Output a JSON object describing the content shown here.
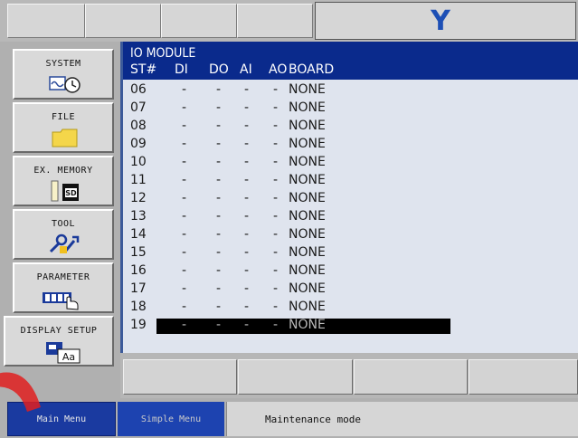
{
  "header": {
    "logo": "Y"
  },
  "left_menu": [
    {
      "label": "SYSTEM",
      "icon": "system-clock-icon"
    },
    {
      "label": "FILE",
      "icon": "folder-icon"
    },
    {
      "label": "EX. MEMORY",
      "icon": "sd-card-icon"
    },
    {
      "label": "TOOL",
      "icon": "tool-icon"
    },
    {
      "label": "PARAMETER",
      "icon": "parameter-hand-icon"
    },
    {
      "label": "DISPLAY SETUP",
      "icon": "display-setup-icon"
    }
  ],
  "main": {
    "title": "IO MODULE",
    "columns": [
      "ST#",
      "DI",
      "DO",
      "AI",
      "AO",
      "BOARD"
    ],
    "rows": [
      {
        "st": "06",
        "di": "-",
        "do": "-",
        "ai": "-",
        "ao": "-",
        "board": "NONE"
      },
      {
        "st": "07",
        "di": "-",
        "do": "-",
        "ai": "-",
        "ao": "-",
        "board": "NONE"
      },
      {
        "st": "08",
        "di": "-",
        "do": "-",
        "ai": "-",
        "ao": "-",
        "board": "NONE"
      },
      {
        "st": "09",
        "di": "-",
        "do": "-",
        "ai": "-",
        "ao": "-",
        "board": "NONE"
      },
      {
        "st": "10",
        "di": "-",
        "do": "-",
        "ai": "-",
        "ao": "-",
        "board": "NONE"
      },
      {
        "st": "11",
        "di": "-",
        "do": "-",
        "ai": "-",
        "ao": "-",
        "board": "NONE"
      },
      {
        "st": "12",
        "di": "-",
        "do": "-",
        "ai": "-",
        "ao": "-",
        "board": "NONE"
      },
      {
        "st": "13",
        "di": "-",
        "do": "-",
        "ai": "-",
        "ao": "-",
        "board": "NONE"
      },
      {
        "st": "14",
        "di": "-",
        "do": "-",
        "ai": "-",
        "ao": "-",
        "board": "NONE"
      },
      {
        "st": "15",
        "di": "-",
        "do": "-",
        "ai": "-",
        "ao": "-",
        "board": "NONE"
      },
      {
        "st": "16",
        "di": "-",
        "do": "-",
        "ai": "-",
        "ao": "-",
        "board": "NONE"
      },
      {
        "st": "17",
        "di": "-",
        "do": "-",
        "ai": "-",
        "ao": "-",
        "board": "NONE"
      },
      {
        "st": "18",
        "di": "-",
        "do": "-",
        "ai": "-",
        "ao": "-",
        "board": "NONE"
      },
      {
        "st": "19",
        "di": "-",
        "do": "-",
        "ai": "-",
        "ao": "-",
        "board": "NONE",
        "selected": true
      }
    ]
  },
  "status_bar": {
    "main_menu": "Main Menu",
    "simple_menu": "Simple Menu",
    "mode": "Maintenance mode"
  },
  "colors": {
    "title_bar": "#0a2a8c",
    "list_background": "#dfe4ee",
    "main_menu_button": "#1a3aa0",
    "logo": "#1d4fb5",
    "watermark": "#e02020"
  }
}
